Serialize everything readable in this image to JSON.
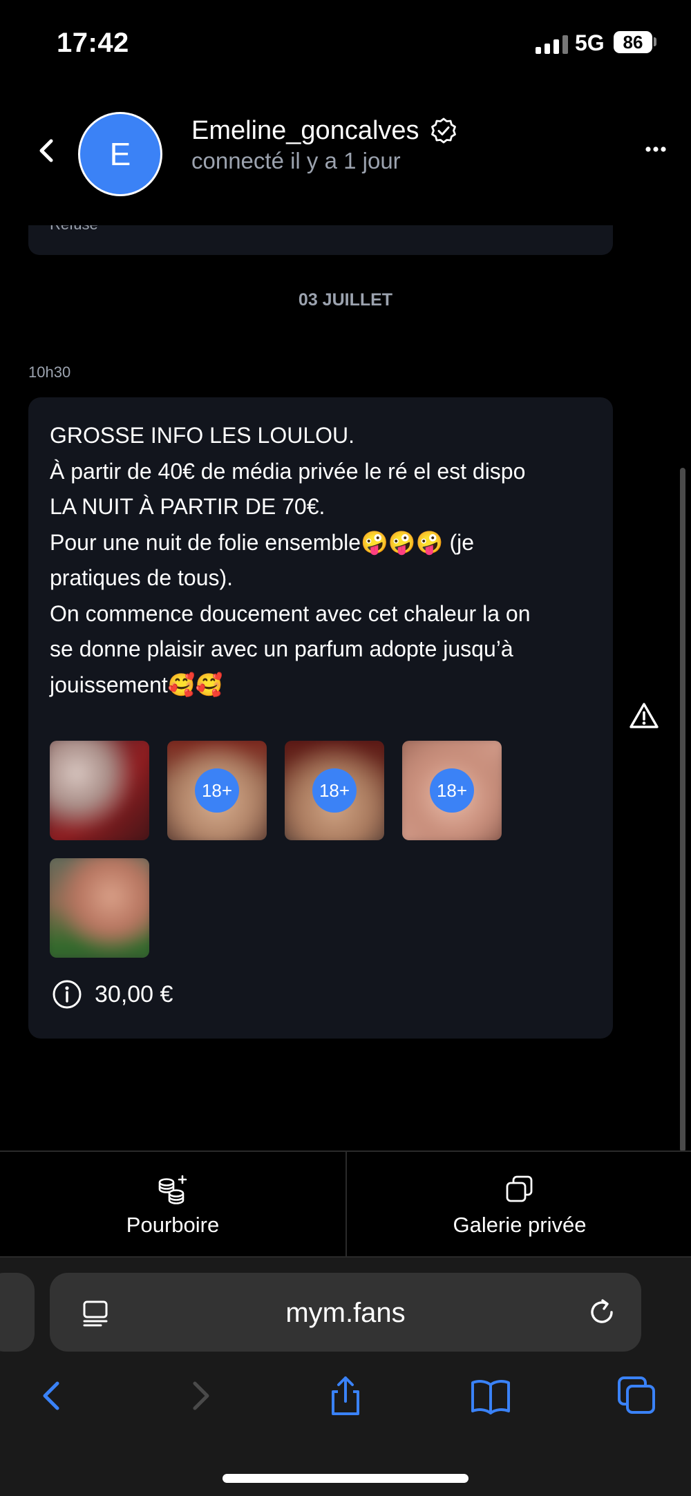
{
  "status": {
    "time": "17:42",
    "network": "5G",
    "battery": "86"
  },
  "header": {
    "avatar_letter": "E",
    "username": "Emeline_goncalves",
    "last_seen": "connecté il y a 1 jour"
  },
  "previous_message": {
    "status_text": "Refusé"
  },
  "date_separator": "03 JUILLET",
  "message": {
    "time": "10h30",
    "text": "GROSSE INFO LES LOULOU.\nÀ partir de 40€ de média privée le ré el est dispo\nLA NUIT À PARTIR DE 70€.\nPour une nuit de folie ensemble🤪🤪🤪 (je\npratiques de tous).\nOn commence doucement avec cet chaleur la on\nse donne plaisir avec un parfum adopte jusqu’à\njouissement🥰🥰",
    "media": [
      {
        "badge": ""
      },
      {
        "badge": "18+"
      },
      {
        "badge": "18+"
      },
      {
        "badge": "18+"
      },
      {
        "badge": ""
      }
    ],
    "price": "30,00 €"
  },
  "actions": {
    "tip_label": "Pourboire",
    "gallery_label": "Galerie privée"
  },
  "browser": {
    "url": "mym.fans"
  },
  "colors": {
    "accent": "#3b82f6",
    "card_bg": "#12151d",
    "muted_text": "#9ca3af",
    "browser_blue": "#3a82f7"
  }
}
